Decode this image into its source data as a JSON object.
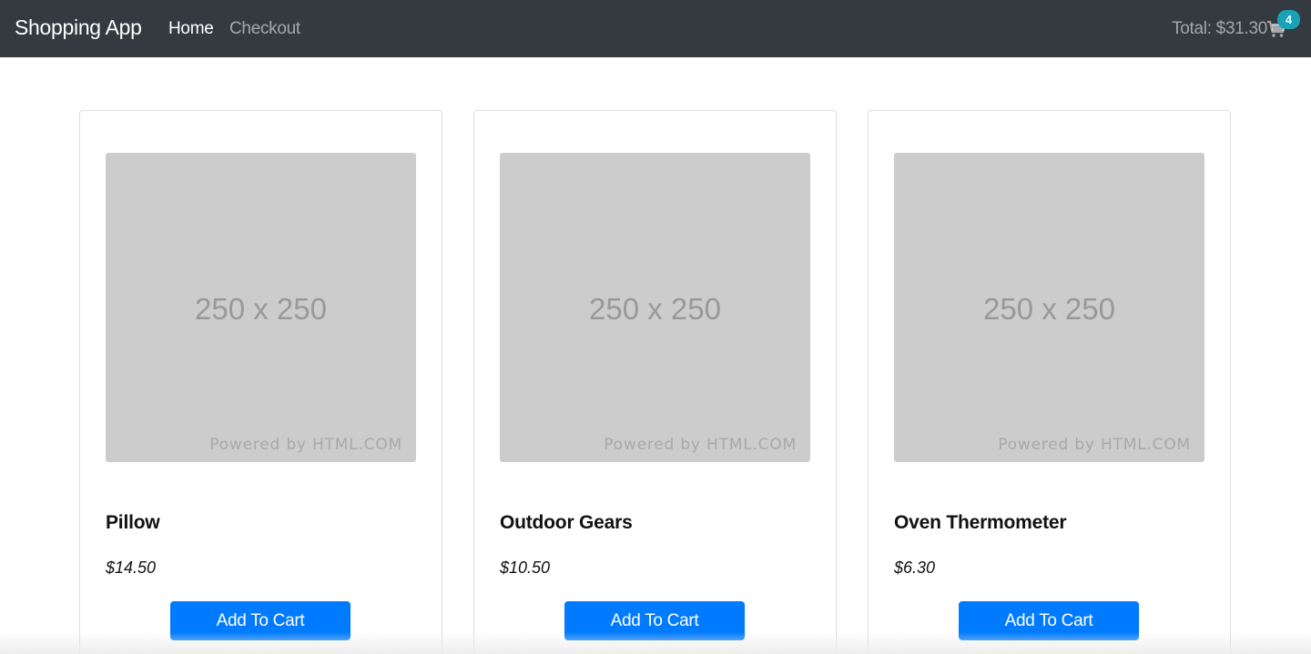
{
  "navbar": {
    "brand": "Shopping App",
    "links": [
      {
        "label": "Home",
        "active": true
      },
      {
        "label": "Checkout",
        "active": false
      }
    ],
    "cart_total": "Total: $31.30",
    "cart_count": "4",
    "cart_icon": "shopping-cart-icon"
  },
  "products": [
    {
      "name": "Pillow",
      "price": "$14.50",
      "image_text": "250 x 250",
      "image_credit": "Powered by HTML.COM",
      "button": "Add To Cart"
    },
    {
      "name": "Outdoor Gears",
      "price": "$10.50",
      "image_text": "250 x 250",
      "image_credit": "Powered by HTML.COM",
      "button": "Add To Cart"
    },
    {
      "name": "Oven Thermometer",
      "price": "$6.30",
      "image_text": "250 x 250",
      "image_credit": "Powered by HTML.COM",
      "button": "Add To Cart"
    }
  ],
  "colors": {
    "navbar_bg": "#343a40",
    "button_primary": "#007bff",
    "badge": "#17a2b8",
    "placeholder_bg": "#cccccc"
  }
}
